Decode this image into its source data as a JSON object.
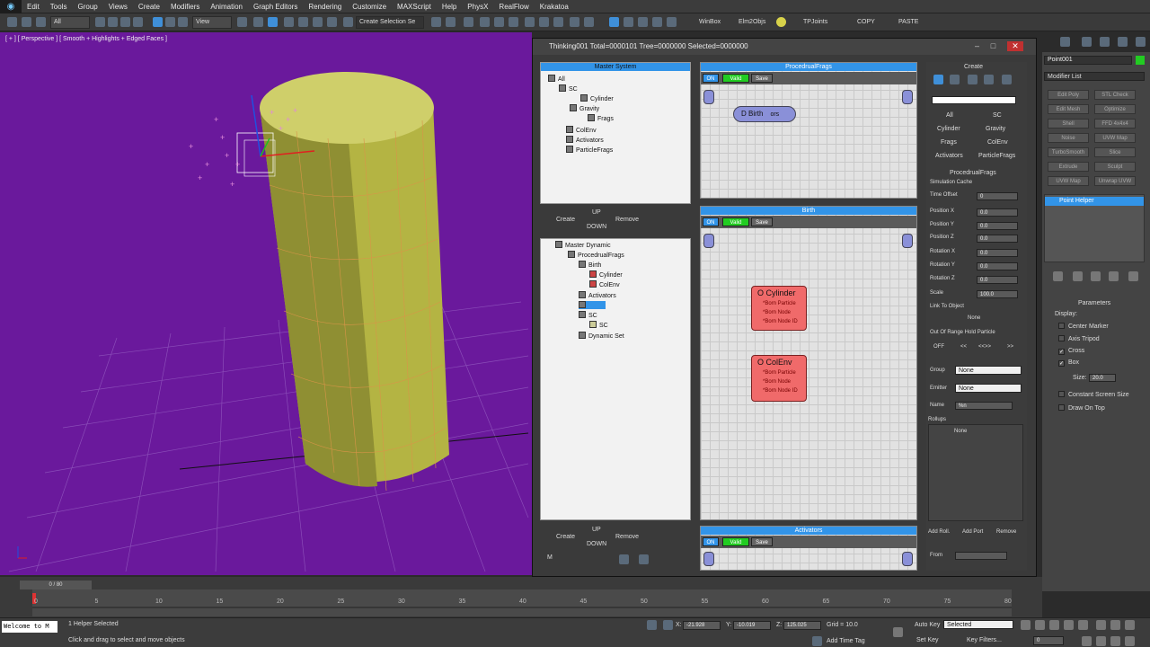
{
  "menubar": {
    "items": [
      "Edit",
      "Tools",
      "Group",
      "Views",
      "Create",
      "Modifiers",
      "Animation",
      "Graph Editors",
      "Rendering",
      "Customize",
      "MAXScript",
      "Help",
      "PhysX",
      "RealFlow",
      "Krakatoa"
    ]
  },
  "toolbar": {
    "selection_filter": "All",
    "ref_coord": "View",
    "named_selection": "Create Selection Se",
    "winbox": "WinBox",
    "elm2objs": "Elm2Objs",
    "tpjoints": "TPJoints",
    "copy": "COPY",
    "paste": "PASTE"
  },
  "viewport": {
    "label": "[ + ] [ Perspective ] [ Smooth + Highlights + Edged Faces ]",
    "bg": "#6a199c"
  },
  "tf": {
    "title": "Thinking001  Total=0000101  Tree=0000000  Selected=0000000",
    "master_system": {
      "header": "Master System",
      "tree": [
        "All",
        "SC",
        "Cylinder",
        "Gravity",
        "Frags",
        "ColEnv",
        "Activators",
        "ParticleFrags"
      ]
    },
    "ms_buttons": {
      "create": "Create",
      "up": "UP",
      "down": "DOWN",
      "remove": "Remove"
    },
    "master_dynamic": {
      "tree": [
        "Master Dynamic",
        "ProcedrualFrags",
        "Birth",
        "Cylinder",
        "ColEnv",
        "Activators",
        "",
        "SC",
        "SC",
        "Dynamic Set"
      ]
    },
    "md_buttons": {
      "create": "Create",
      "up": "UP",
      "down": "DOWN",
      "remove": "Remove",
      "m": "M"
    },
    "graphs": [
      {
        "header": "ProcedrualFrags",
        "on": "ON",
        "valid": "Valid",
        "save": "Save"
      },
      {
        "header": "Birth",
        "on": "ON",
        "valid": "Valid",
        "save": "Save"
      },
      {
        "header": "Activators",
        "on": "ON",
        "valid": "Valid",
        "save": "Save"
      }
    ],
    "birth_node": "D Birth",
    "birth_node_suffix": "ors",
    "nodes": [
      {
        "title": "O Cylinder",
        "lines": [
          "*Born Particle",
          "*Born Node",
          "*Born Node ID"
        ]
      },
      {
        "title": "O ColEnv",
        "lines": [
          "*Born Particle",
          "*Born Node",
          "*Born Node ID"
        ]
      }
    ]
  },
  "create_panel": {
    "header": "Create",
    "grid": [
      "All",
      "SC",
      "Cylinder",
      "Gravity",
      "Frags",
      "ColEnv",
      "Activators",
      "ParticleFrags"
    ],
    "rollout": "ProcedrualFrags",
    "sim_cache": "Simulation Cache",
    "params": [
      {
        "label": "Time Offset",
        "value": "0"
      },
      {
        "label": "Position X",
        "value": "0.0"
      },
      {
        "label": "Position Y",
        "value": "0.0"
      },
      {
        "label": "Position Z",
        "value": "0.0"
      },
      {
        "label": "Rotation X",
        "value": "0.0"
      },
      {
        "label": "Rotation Y",
        "value": "0.0"
      },
      {
        "label": "Rotation Z",
        "value": "0.0"
      },
      {
        "label": "Scale",
        "value": "100.0"
      }
    ],
    "link_to_object": "Link To Object",
    "none": "None",
    "out_of_range": "Out Of Range Hold Particle",
    "range_btns": [
      "OFF",
      "<<",
      "<<>>",
      ">>"
    ],
    "group_label": "Group",
    "group_value": "None",
    "emitter_label": "Emitter",
    "emitter_value": "None",
    "name_label": "Name",
    "name_value": "%n",
    "rollups": "Rollups",
    "rollups_none": "None",
    "add_roll": "Add Roll.",
    "add_port": "Add Port",
    "remove": "Remove",
    "from": "From"
  },
  "modify_panel": {
    "object_name": "Point001",
    "color": "#22cc22",
    "modifier_list": "Modifier List",
    "modifiers": [
      "Edit Poly",
      "STL Check",
      "Edit Mesh",
      "Optimize",
      "Shell",
      "FFD 4x4x4",
      "Noise",
      "UVW Map",
      "TurboSmooth",
      "Slice",
      "Extrude",
      "Sculpt",
      "UVW Map",
      "Unwrap UVW"
    ],
    "stack_item": "Point Helper",
    "params_header": "Parameters",
    "display": "Display:",
    "checks": [
      {
        "label": "Center Marker",
        "checked": false
      },
      {
        "label": "Axis Tripod",
        "checked": false
      },
      {
        "label": "Cross",
        "checked": true
      },
      {
        "label": "Box",
        "checked": true
      }
    ],
    "size_label": "Size:",
    "size_value": "20.0",
    "constant": "Constant Screen Size",
    "draw_on_top": "Draw On Top"
  },
  "timeline": {
    "slider": "0 / 80",
    "ticks": [
      "0",
      "5",
      "10",
      "15",
      "20",
      "25",
      "30",
      "35",
      "40",
      "45",
      "50",
      "55",
      "60",
      "65",
      "70",
      "75",
      "80"
    ]
  },
  "status": {
    "welcome": "Welcome to M",
    "selected": "1 Helper Selected",
    "prompt": "Click and drag to select and move objects",
    "x": "-21.928",
    "y": "-10.019",
    "z": "125.025",
    "grid": "Grid = 10.0",
    "add_time_tag": "Add Time Tag",
    "auto_key": "Auto Key",
    "selected_dd": "Selected",
    "set_key": "Set Key",
    "key_filters": "Key Filters...",
    "frame": "0"
  }
}
